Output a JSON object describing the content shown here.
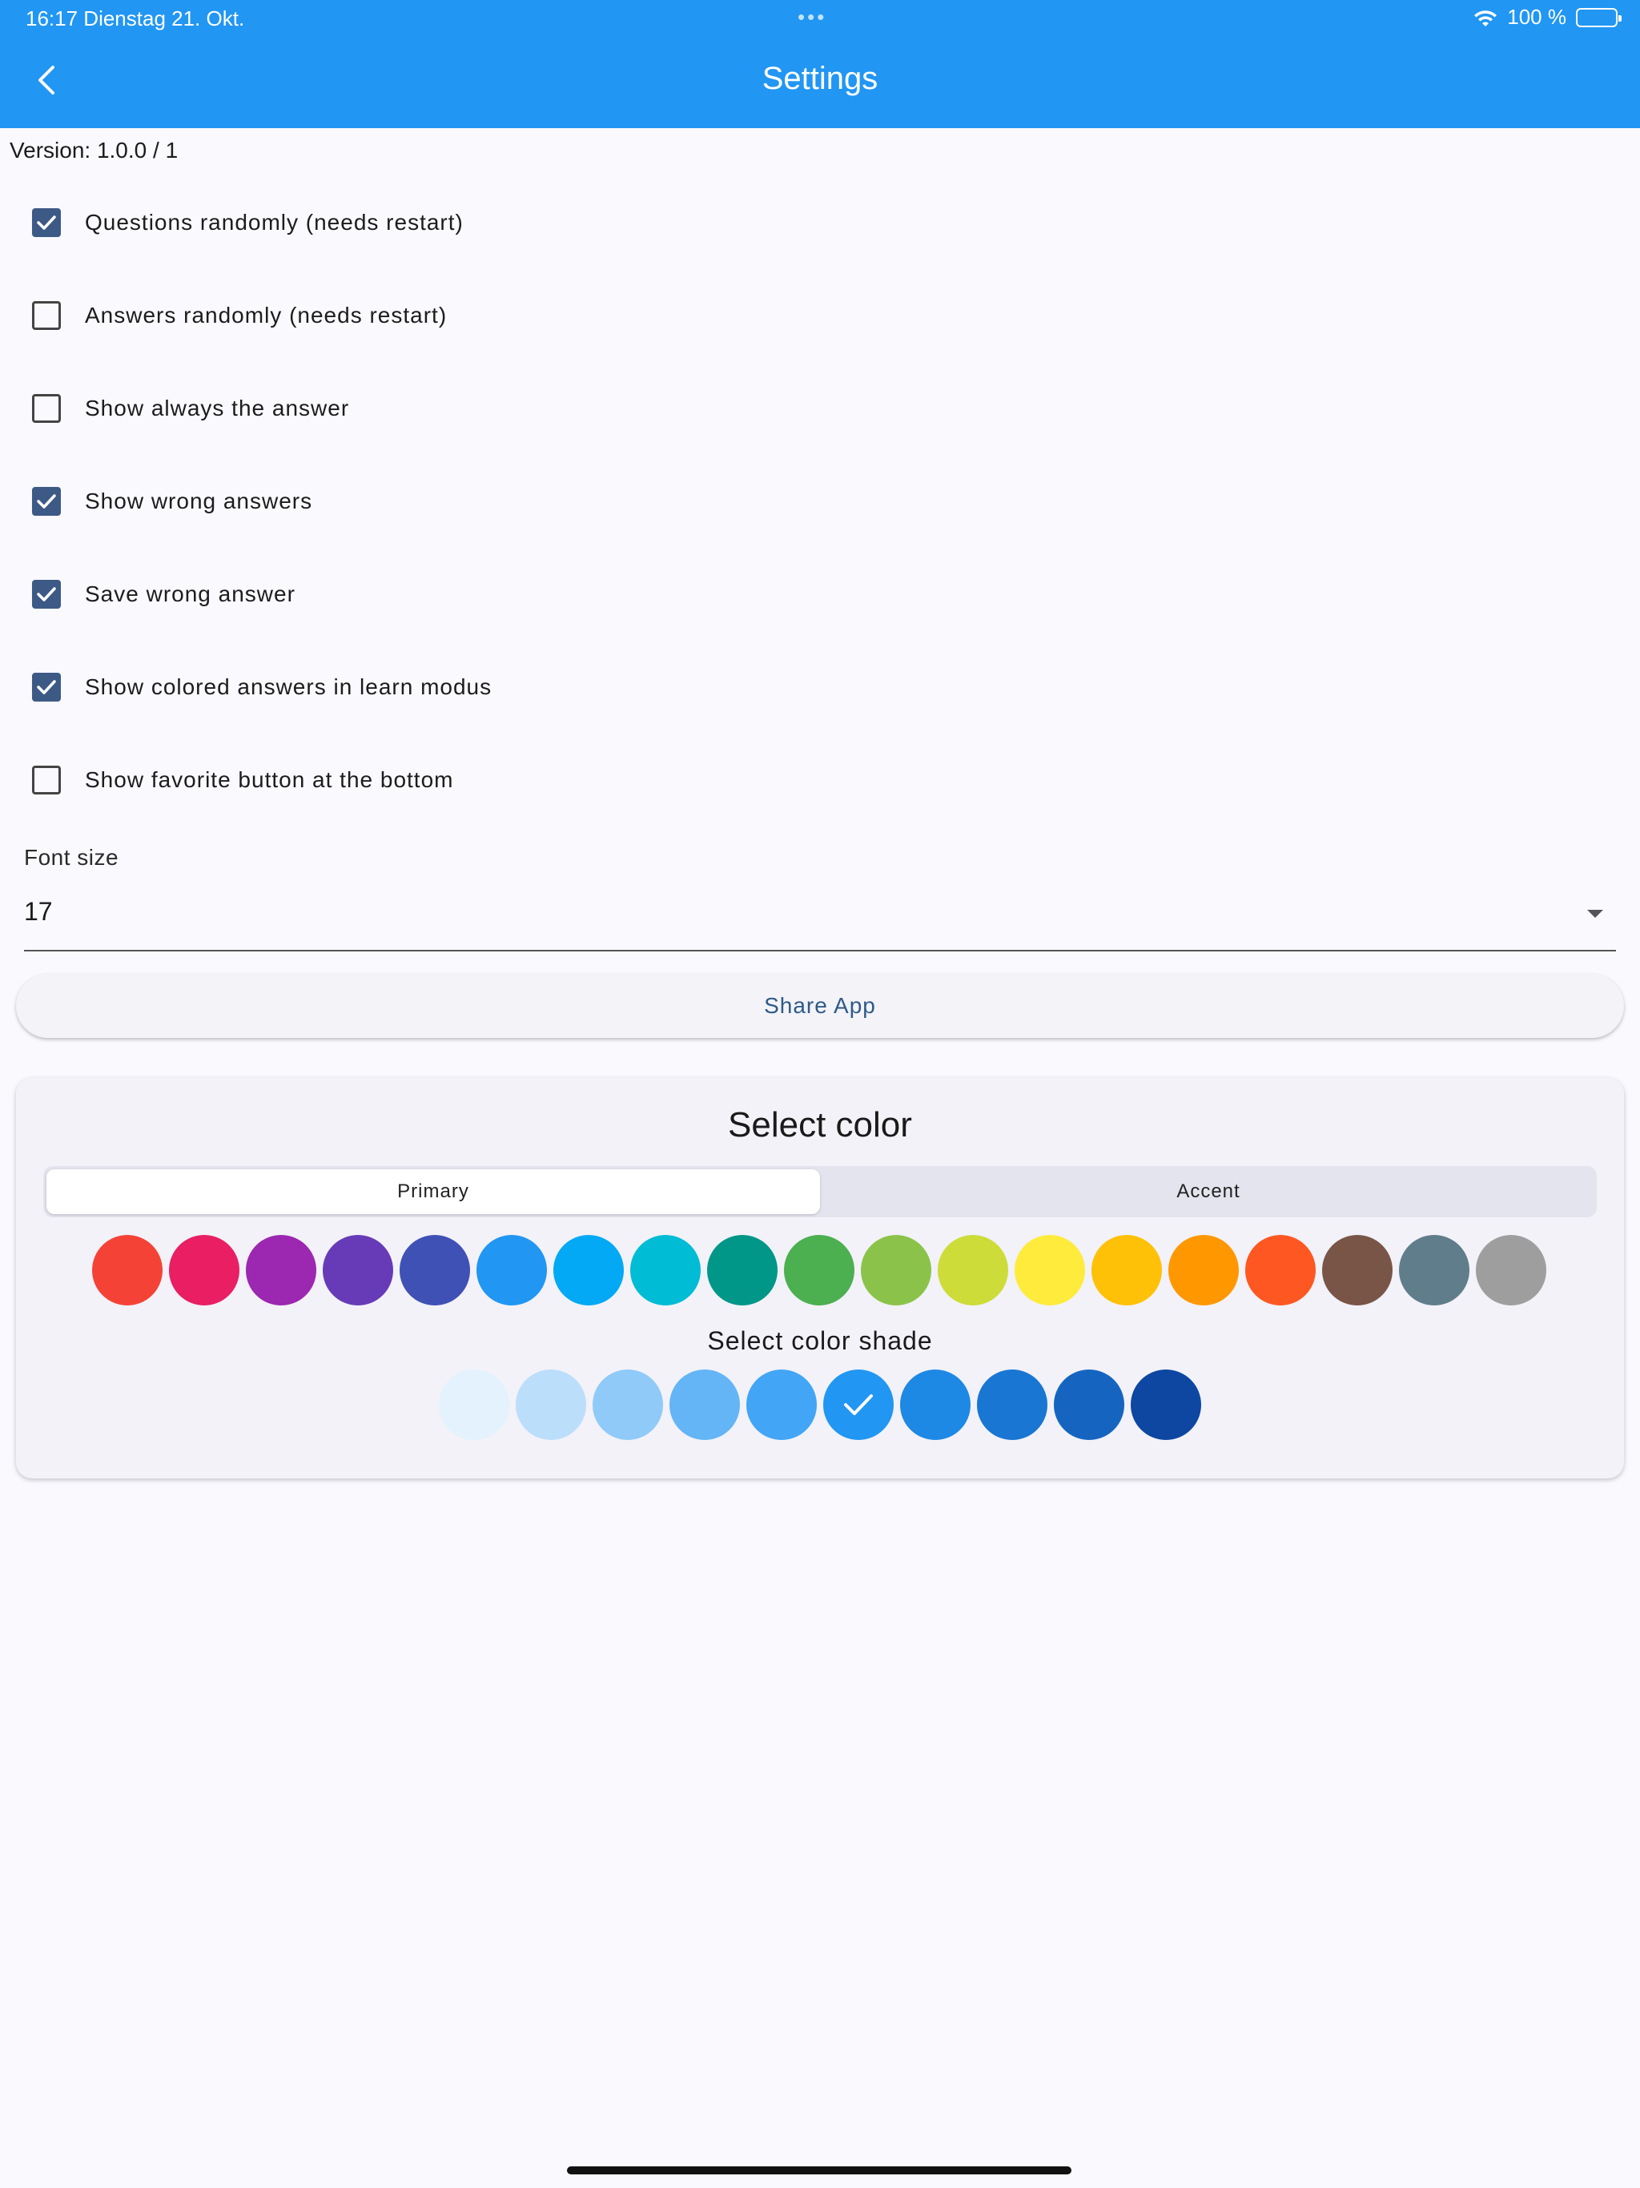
{
  "status_bar": {
    "time_date": "16:17   Dienstag 21. Okt.",
    "dots": "•••",
    "battery": "100 %"
  },
  "header": {
    "title": "Settings"
  },
  "version": "Version: 1.0.0 / 1",
  "settings": [
    {
      "label": "Questions randomly (needs restart)",
      "checked": true
    },
    {
      "label": "Answers randomly (needs restart)",
      "checked": false
    },
    {
      "label": "Show always the answer",
      "checked": false
    },
    {
      "label": "Show wrong answers",
      "checked": true
    },
    {
      "label": "Save wrong answer",
      "checked": true
    },
    {
      "label": "Show colored answers in learn modus",
      "checked": true
    },
    {
      "label": "Show favorite button at the bottom",
      "checked": false
    }
  ],
  "font_size": {
    "label": "Font size",
    "value": "17"
  },
  "share_label": "Share App",
  "color_picker": {
    "title": "Select color",
    "tabs": [
      "Primary",
      "Accent"
    ],
    "selected_tab": "Primary",
    "colors": [
      "#f44336",
      "#e91e63",
      "#9c27b0",
      "#673ab7",
      "#3f51b5",
      "#2196f3",
      "#03a9f4",
      "#00bcd4",
      "#009688",
      "#4caf50",
      "#8bc34a",
      "#cddc39",
      "#ffeb3b",
      "#ffc107",
      "#ff9800",
      "#ff5722",
      "#795548",
      "#607d8b",
      "#9e9e9e"
    ],
    "shade_title": "Select color shade",
    "shades": [
      "#e3f2fd",
      "#bbdefb",
      "#90caf9",
      "#64b5f6",
      "#42a5f5",
      "#2196f3",
      "#1e88e5",
      "#1976d2",
      "#1565c0",
      "#0d47a1"
    ],
    "selected_shade": "#2196f3"
  },
  "colors": {
    "app_bar": "#2196f3",
    "checkbox_checked": "#3d5a86",
    "share_text": "#2f5a88"
  }
}
